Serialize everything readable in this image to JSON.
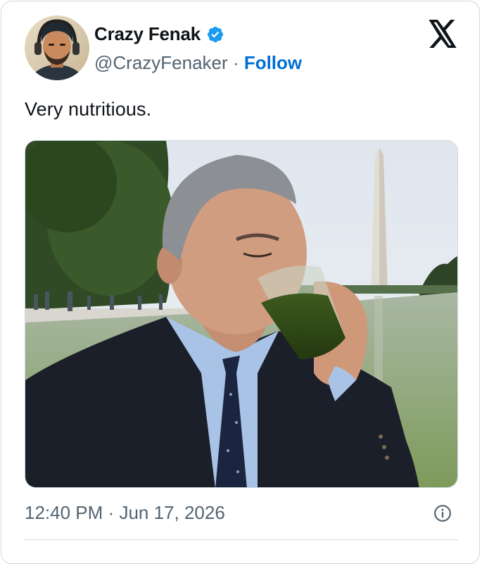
{
  "author": {
    "display_name": "Crazy Fenak",
    "handle": "@CrazyFenaker",
    "separator": "·",
    "follow_label": "Follow",
    "verified": true
  },
  "tweet": {
    "text": "Very nutritious.",
    "time": "12:40 PM",
    "date_separator": "·",
    "date": "Jun 17, 2026"
  },
  "icons": {
    "verified": "verified-badge-icon",
    "platform": "x-logo-icon",
    "info": "info-icon"
  },
  "colors": {
    "follow": "#006fd6",
    "verified": "#1d9bf0",
    "secondary_text": "#536471",
    "border": "#cfd9de"
  }
}
